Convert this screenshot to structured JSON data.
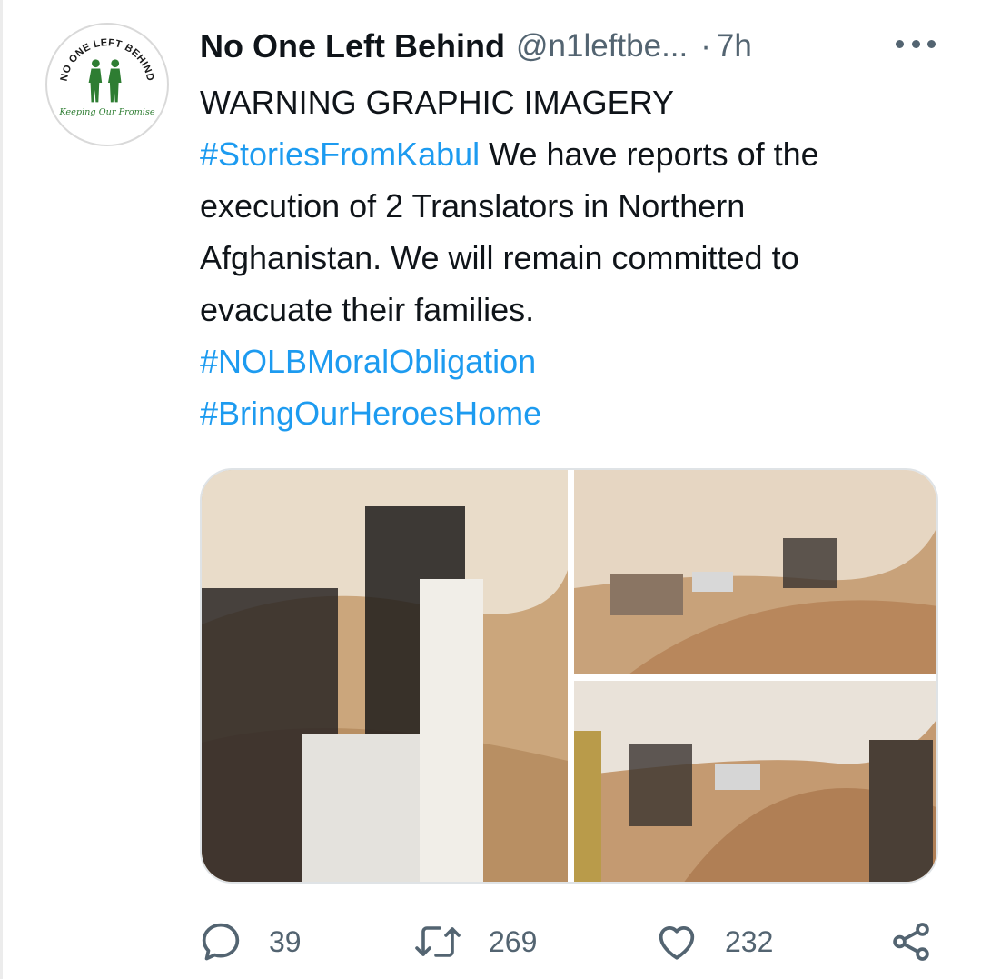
{
  "tweet": {
    "display_name": "No One Left Behind",
    "handle": "@n1leftbe...",
    "separator": "·",
    "time": "7h",
    "lines": [
      [
        {
          "text": "WARNING GRAPHIC IMAGERY",
          "tag": false
        }
      ],
      [
        {
          "text": "#StoriesFromKabul",
          "tag": true
        },
        {
          "text": " We have reports of the",
          "tag": false
        }
      ],
      [
        {
          "text": "execution of 2 Translators in Northern",
          "tag": false
        }
      ],
      [
        {
          "text": "Afghanistan. We will remain committed to",
          "tag": false
        }
      ],
      [
        {
          "text": "evacuate their families.",
          "tag": false
        }
      ],
      [
        {
          "text": "#NOLBMoralObligation",
          "tag": true
        }
      ],
      [
        {
          "text": "#BringOurHeroesHome",
          "tag": true
        }
      ]
    ]
  },
  "avatar": {
    "logo_top_text": "NO ONE LEFT BEHIND",
    "logo_script_text": "Keeping Our Promise"
  },
  "media": {
    "photos": [
      {
        "name": "photo-left",
        "icon": "photo"
      },
      {
        "name": "photo-top-right",
        "icon": "photo"
      },
      {
        "name": "photo-bottom-right",
        "icon": "photo"
      }
    ]
  },
  "actions": {
    "reply_count": "39",
    "retweet_count": "269",
    "like_count": "232",
    "icons": [
      "reply-icon",
      "retweet-icon",
      "like-icon",
      "share-icon"
    ]
  },
  "colors": {
    "link": "#1d9bf0",
    "secondary": "#536471",
    "text": "#0f1419",
    "logo_green": "#2e7d32"
  }
}
